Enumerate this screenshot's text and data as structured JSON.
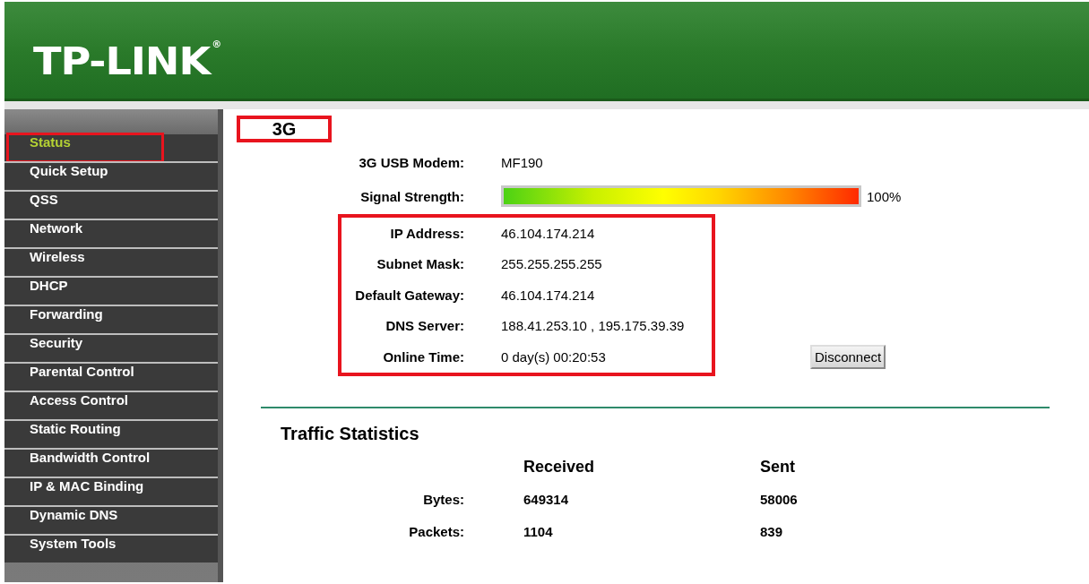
{
  "header": {
    "logo": "TP-LINK",
    "registered_mark": "®"
  },
  "sidebar": {
    "items": [
      {
        "label": "Status",
        "selected": true,
        "highlighted": true
      },
      {
        "label": "Quick Setup",
        "selected": false,
        "highlighted": false
      },
      {
        "label": "QSS",
        "selected": false,
        "highlighted": false
      },
      {
        "label": "Network",
        "selected": false,
        "highlighted": false
      },
      {
        "label": "Wireless",
        "selected": false,
        "highlighted": false
      },
      {
        "label": "DHCP",
        "selected": false,
        "highlighted": false
      },
      {
        "label": "Forwarding",
        "selected": false,
        "highlighted": false
      },
      {
        "label": "Security",
        "selected": false,
        "highlighted": false
      },
      {
        "label": "Parental Control",
        "selected": false,
        "highlighted": false
      },
      {
        "label": "Access Control",
        "selected": false,
        "highlighted": false
      },
      {
        "label": "Static Routing",
        "selected": false,
        "highlighted": false
      },
      {
        "label": "Bandwidth Control",
        "selected": false,
        "highlighted": false
      },
      {
        "label": "IP & MAC Binding",
        "selected": false,
        "highlighted": false
      },
      {
        "label": "Dynamic DNS",
        "selected": false,
        "highlighted": false
      },
      {
        "label": "System Tools",
        "selected": false,
        "highlighted": false
      }
    ]
  },
  "section": {
    "title": "3G",
    "title_highlighted": true,
    "rows": [
      {
        "kind": "text",
        "label": "3G USB Modem:",
        "value": "MF190",
        "highlighted": false
      },
      {
        "kind": "meter",
        "label": "Signal Strength:",
        "level": 1,
        "reading": "100%",
        "highlighted": false
      },
      {
        "kind": "text",
        "label": "IP Address:",
        "value": "46.104.174.214",
        "highlighted": true
      },
      {
        "kind": "text",
        "label": "Subnet Mask:",
        "value": "255.255.255.255",
        "highlighted": true
      },
      {
        "kind": "text",
        "label": "Default Gateway:",
        "value": "46.104.174.214",
        "highlighted": true
      },
      {
        "kind": "text",
        "label": "DNS Server:",
        "value": "188.41.253.10 , 195.175.39.39",
        "highlighted": true
      },
      {
        "kind": "text",
        "label": "Online Time:",
        "value": "0 day(s) 00:20:53",
        "highlighted": true
      }
    ],
    "button": "Disconnect"
  },
  "traffic": {
    "title": "Traffic Statistics",
    "columns": [
      "Received",
      "Sent"
    ],
    "rows": [
      {
        "label": "Bytes:",
        "values": [
          "649314",
          "58006"
        ]
      },
      {
        "label": "Packets:",
        "values": [
          "1104",
          "839"
        ]
      }
    ]
  }
}
